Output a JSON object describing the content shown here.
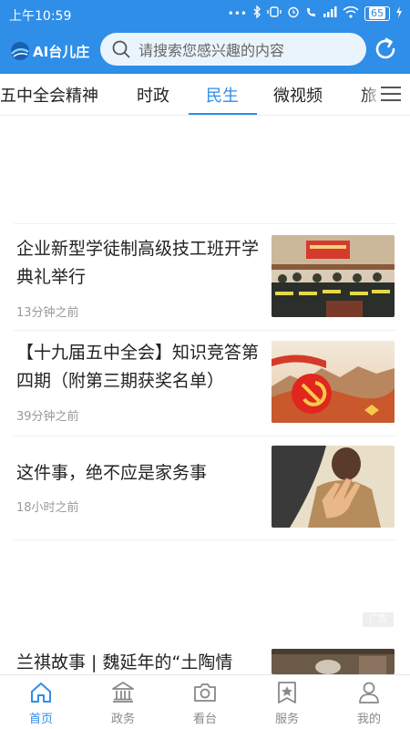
{
  "status_bar": {
    "time": "上午10:59",
    "battery": "65"
  },
  "app": {
    "logo_text": "AI台儿庄",
    "search_placeholder": "请搜索您感兴趣的内容"
  },
  "tabs": [
    {
      "label": "五中全会精神"
    },
    {
      "label": "时政"
    },
    {
      "label": "民生"
    },
    {
      "label": "微视频"
    },
    {
      "label": "旅"
    }
  ],
  "active_tab": "民生",
  "news": [
    {
      "title": "企业新型学徒制高级技工班开学典礼举行",
      "time": "13分钟之前",
      "thumb": "meeting-hall-photo"
    },
    {
      "title": "【十九届五中全会】知识竞答第四期（附第三期获奖名单）",
      "time": "39分钟之前",
      "thumb": "party-emblem-great-wall"
    },
    {
      "title": "这件事，绝不应是家务事",
      "time": "18小时之前",
      "thumb": "hand-stop-illustration"
    },
    {
      "title": "兰祺故事 | 魏延年的“土陶情",
      "time": "",
      "thumb": "pottery-photo"
    }
  ],
  "ad_label": "广告",
  "bottom_nav": [
    {
      "label": "首页",
      "icon": "home-icon",
      "active": true
    },
    {
      "label": "政务",
      "icon": "government-icon",
      "active": false
    },
    {
      "label": "看台",
      "icon": "camera-icon",
      "active": false
    },
    {
      "label": "服务",
      "icon": "service-star-icon",
      "active": false
    },
    {
      "label": "我的",
      "icon": "user-icon",
      "active": false
    }
  ],
  "colors": {
    "primary": "#2f8ee8",
    "text": "#222222",
    "muted": "#999999"
  }
}
